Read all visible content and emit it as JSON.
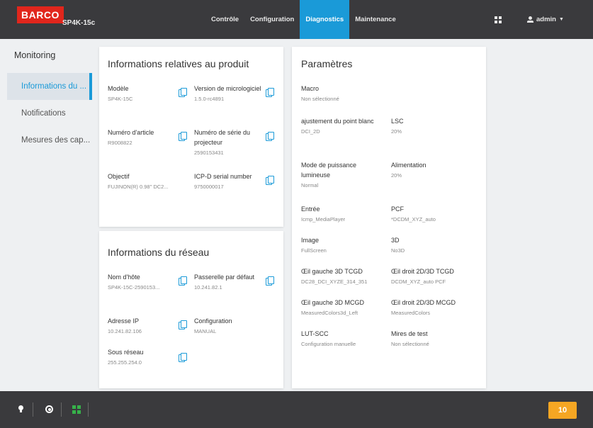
{
  "header": {
    "brand": "BARCO",
    "model": "SP4K-15c",
    "nav": [
      "Contrôle",
      "Configuration",
      "Diagnostics",
      "Maintenance"
    ],
    "active_nav": "Diagnostics",
    "user": "admin",
    "icons": [
      "grid-icon",
      "user-icon",
      "chevron-down-icon"
    ],
    "accent_color": "#1a9ad8",
    "brand_color": "#e1261c"
  },
  "sidebar": {
    "title": "Monitoring",
    "items": [
      {
        "label": "Informations du ..."
      },
      {
        "label": "Notifications"
      },
      {
        "label": "Mesures des cap..."
      }
    ]
  },
  "product": {
    "title": "Informations relatives au produit",
    "fields": [
      {
        "label": "Modèle",
        "value": "SP4K-15C"
      },
      {
        "label": "Version de micrologiciel",
        "value": "1.5.0-rc4891"
      },
      {
        "label": "Numéro d'article",
        "value": "R9008822"
      },
      {
        "label": "Numéro de série du projecteur",
        "value": "2590153431"
      },
      {
        "label": "Objectif",
        "value": "FUJINON(R) 0.98\" DC2..."
      },
      {
        "label": "ICP-D serial number",
        "value": "9750000017"
      }
    ]
  },
  "network": {
    "title": "Informations du réseau",
    "fields": [
      {
        "label": "Nom d'hôte",
        "value": "SP4K-15C-2590153..."
      },
      {
        "label": "Passerelle par défaut",
        "value": "10.241.82.1"
      },
      {
        "label": "Adresse IP",
        "value": "10.241.82.106"
      },
      {
        "label": "Configuration",
        "value": "MANUAL"
      },
      {
        "label": "Sous réseau",
        "value": "255.255.254.0"
      }
    ]
  },
  "params": {
    "title": "Paramètres",
    "fields": [
      {
        "label": "Macro",
        "value": "Non sélectionné"
      },
      {
        "label": "ajustement du point blanc",
        "value": "DCI_2D"
      },
      {
        "label": "LSC",
        "value": "20%"
      },
      {
        "label": "Mode de puissance lumineuse",
        "value": "Normal"
      },
      {
        "label": "Alimentation",
        "value": "20%"
      },
      {
        "label": "Entrée",
        "value": "Icmp_MediaPlayer"
      },
      {
        "label": "PCF",
        "value": "*DCDM_XYZ_auto"
      },
      {
        "label": "Image",
        "value": "FullScreen"
      },
      {
        "label": "3D",
        "value": "No3D"
      },
      {
        "label": "Œil gauche 3D TCGD",
        "value": "DC28_DCI_XYZE_314_351"
      },
      {
        "label": "Œil droit 2D/3D TCGD",
        "value": "DCDM_XYZ_auto PCF"
      },
      {
        "label": "Œil gauche 3D MCGD",
        "value": "MeasuredColors3d_Left"
      },
      {
        "label": "Œil droit 2D/3D MCGD",
        "value": "MeasuredColors"
      },
      {
        "label": "LUT-SCC",
        "value": "Configuration manuelle"
      },
      {
        "label": "Mires de test",
        "value": "Non sélectionné"
      }
    ]
  },
  "footer": {
    "icons": [
      "lamp-icon",
      "shutter-icon",
      "test-pattern-icon"
    ],
    "notification_count": "10",
    "badge_color": "#f5a623"
  }
}
